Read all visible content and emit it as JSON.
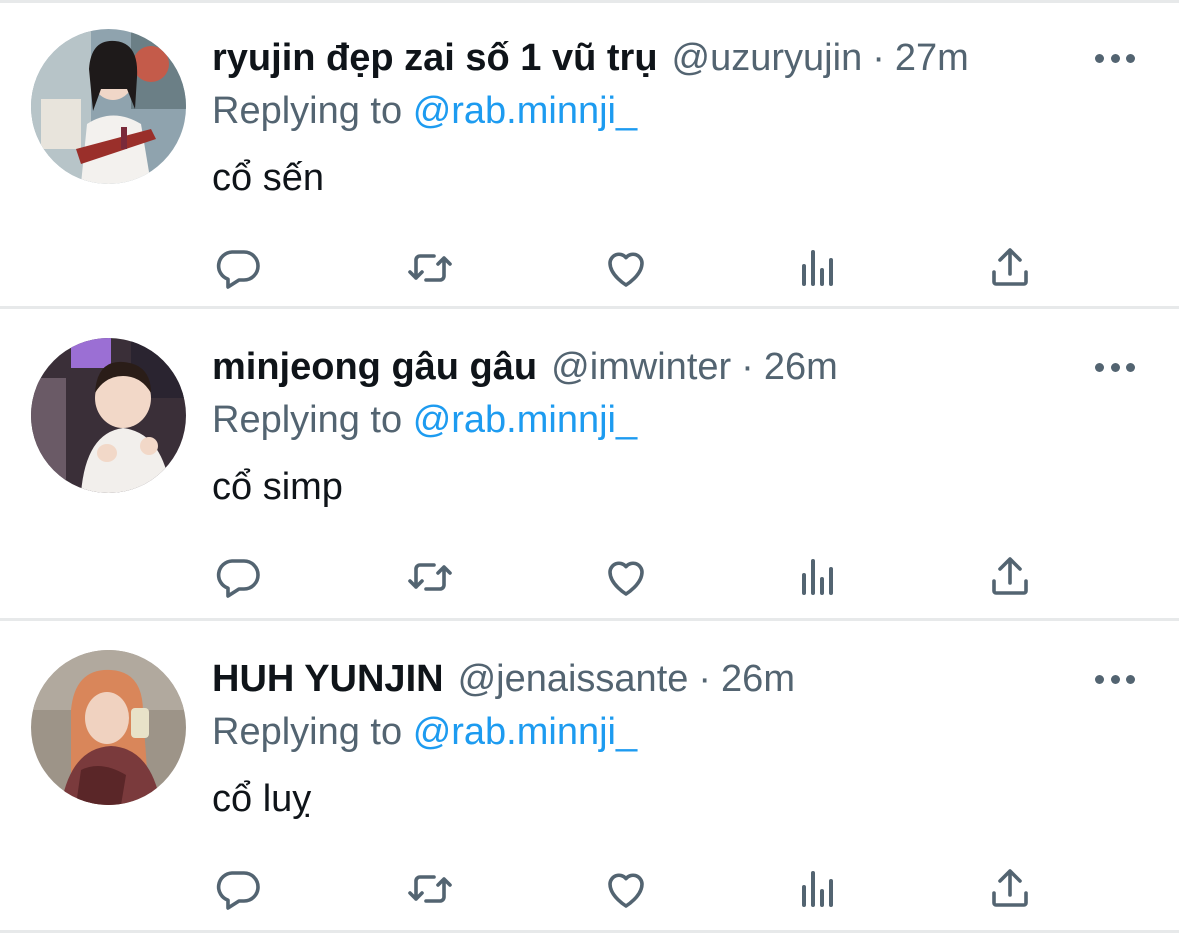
{
  "colors": {
    "text_primary": "#0f1419",
    "text_secondary": "#536471",
    "link": "#1d9bf0",
    "divider": "#e7e9ea"
  },
  "tweets": [
    {
      "display_name": "ryujin đẹp zai số 1 vũ trụ",
      "handle": "@uzuryujin",
      "separator": "·",
      "time": "27m",
      "replying_to_prefix": "Replying to",
      "replying_to_handle": "@rab.minnji_",
      "text": "cổ sến",
      "avatar_icon": "profile-photo",
      "action_icons": [
        "reply-icon",
        "retweet-icon",
        "like-icon",
        "analytics-icon",
        "share-icon"
      ]
    },
    {
      "display_name": "minjeong gâu gâu",
      "handle": "@imwinter",
      "separator": "·",
      "time": "26m",
      "replying_to_prefix": "Replying to",
      "replying_to_handle": "@rab.minnji_",
      "text": "cổ simp",
      "avatar_icon": "profile-photo",
      "action_icons": [
        "reply-icon",
        "retweet-icon",
        "like-icon",
        "analytics-icon",
        "share-icon"
      ]
    },
    {
      "display_name": "HUH YUNJIN",
      "handle": "@jenaissante",
      "separator": "·",
      "time": "26m",
      "replying_to_prefix": "Replying to",
      "replying_to_handle": "@rab.minnji_",
      "text": "cổ luỵ",
      "avatar_icon": "profile-photo",
      "action_icons": [
        "reply-icon",
        "retweet-icon",
        "like-icon",
        "analytics-icon",
        "share-icon"
      ]
    }
  ]
}
